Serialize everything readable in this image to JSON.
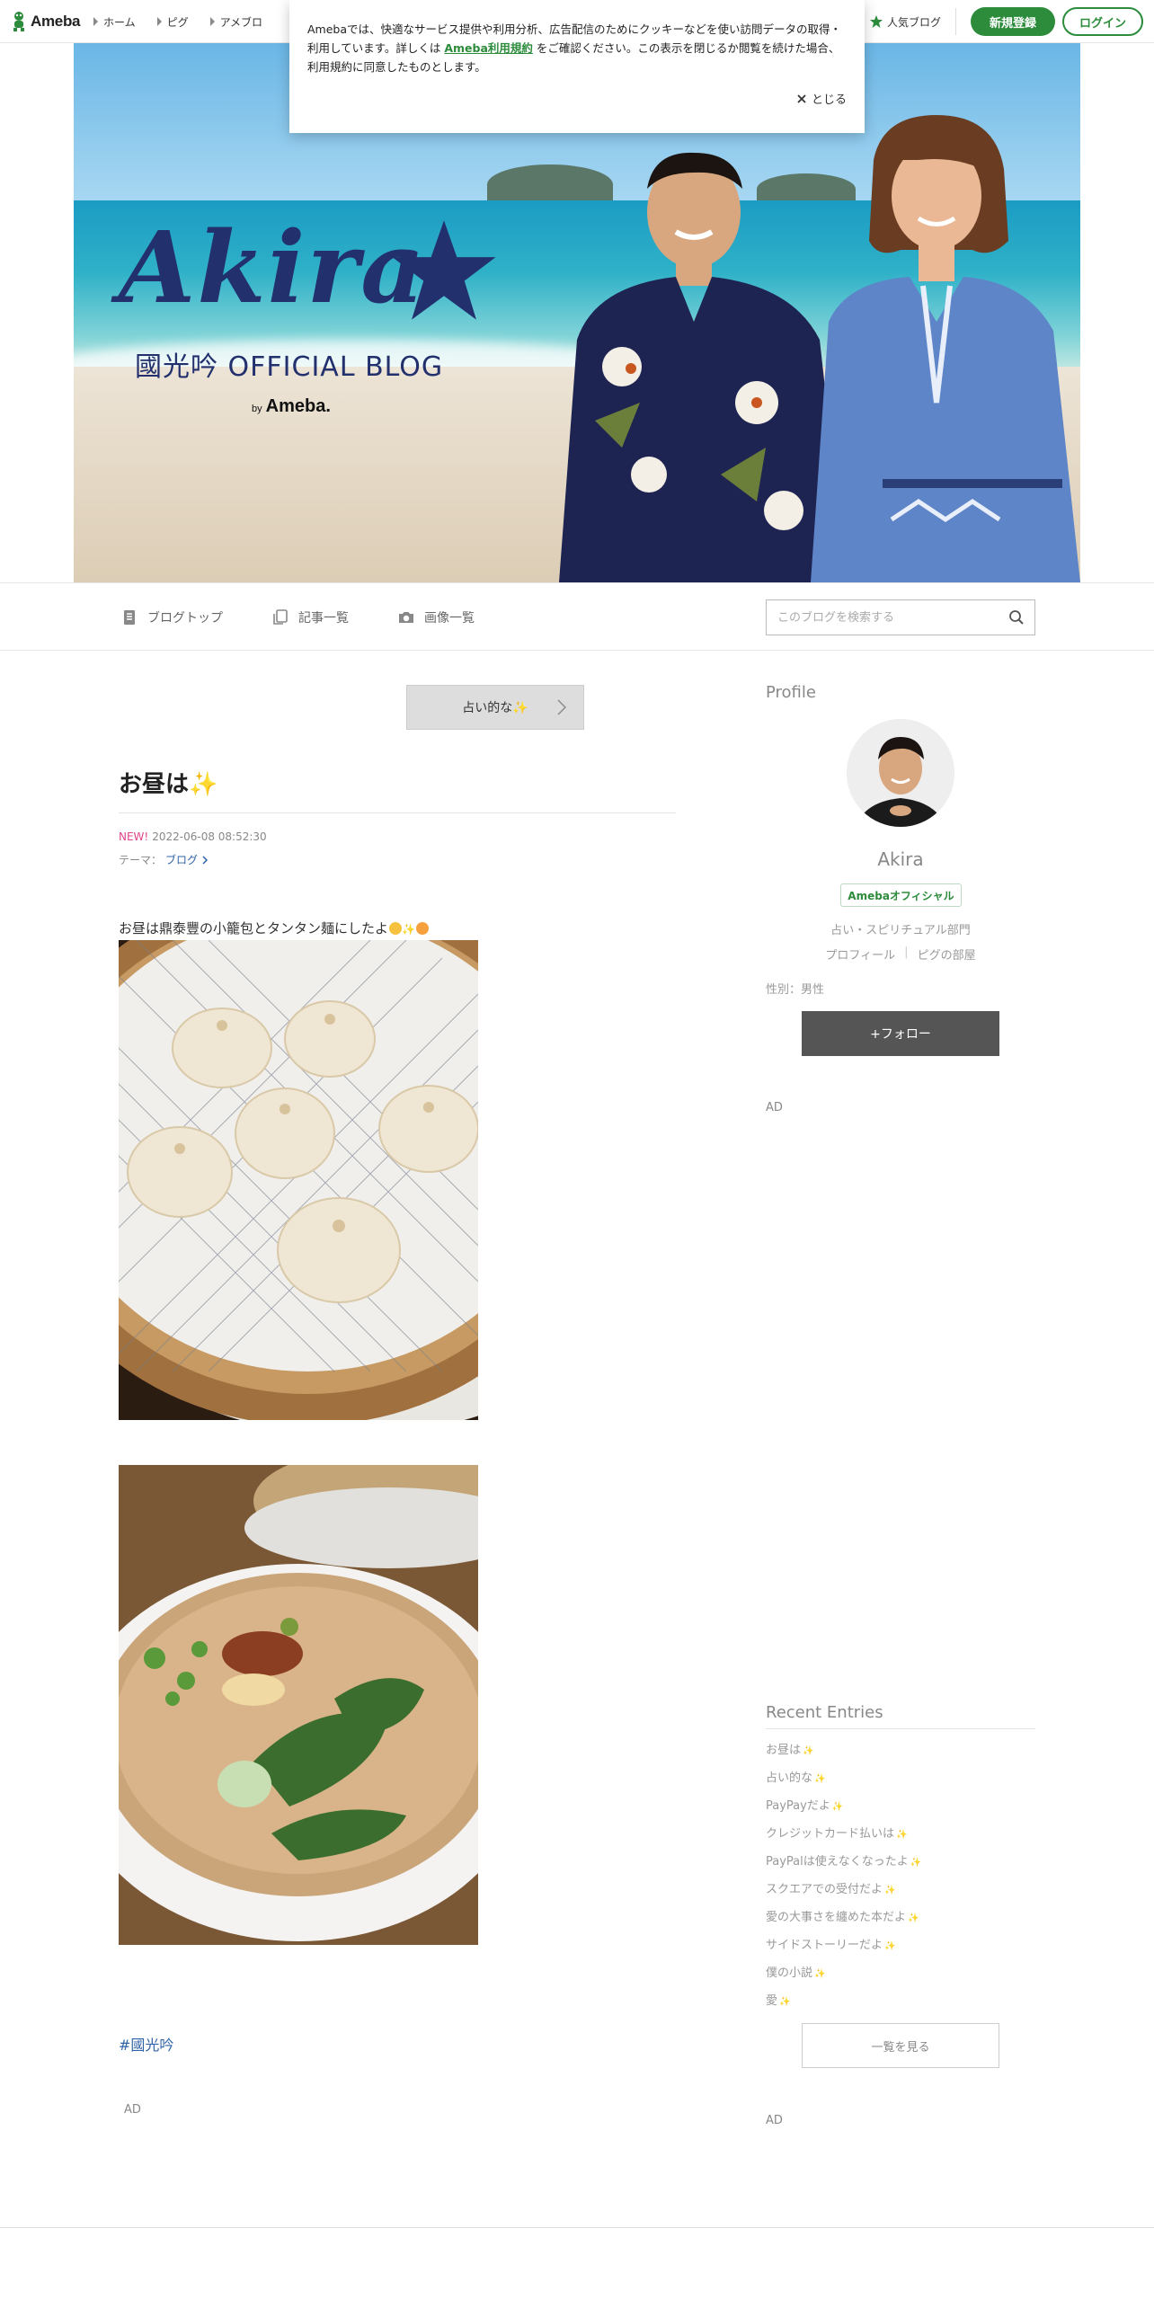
{
  "header": {
    "logo_text": "Ameba",
    "nav": [
      "ホーム",
      "ピグ",
      "アメブロ"
    ],
    "popular_label": "人気ブログ",
    "signup_label": "新規登録",
    "login_label": "ログイン"
  },
  "cookie": {
    "text_before": "Amebaでは、快適なサービス提供や利用分析、広告配信のためにクッキーなどを使い訪問データの取得・利用しています。詳しくは ",
    "link": "Ameba利用規約",
    "text_after": " をご確認ください。この表示を閉じるか閲覧を続けた場合、利用規約に同意したものとします。",
    "close_label": "とじる"
  },
  "hero": {
    "title": "Akira",
    "subtitle": "國光吟 OFFICIAL BLOG",
    "by_small": "by",
    "by_brand": "Ameba."
  },
  "blognav": {
    "items": [
      "ブログトップ",
      "記事一覧",
      "画像一覧"
    ],
    "search_placeholder": "このブログを検索する"
  },
  "entry": {
    "prev_label": "占い的な✨",
    "title": "お昼は✨",
    "new_badge": "NEW!",
    "date": "2022-06-08 08:52:30",
    "theme_prefix": "テーマ：",
    "theme": "ブログ",
    "body": "お昼は鼎泰豐の小籠包とタンタン麺にしたよ",
    "hashtag": "#國光吟",
    "ad": "AD"
  },
  "sidebar": {
    "profile_heading": "Profile",
    "name": "Akira",
    "official_badge": "Amebaオフィシャル",
    "category": "占い・スピリチュアル部門",
    "links": [
      "プロフィール",
      "ピグの部屋"
    ],
    "gender": "性別：男性",
    "follow_label": "+フォロー",
    "ad1": "AD",
    "recent_heading": "Recent Entries",
    "recent": [
      "お昼は",
      "占い的な",
      "PayPayだよ",
      "クレジットカード払いは",
      "PayPalは使えなくなったよ",
      "スクエアでの受付だよ",
      "愛の大事さを纏めた本だよ",
      "サイドストーリーだよ",
      "僕の小説",
      "愛"
    ],
    "see_all_label": "一覧を見る",
    "ad2": "AD"
  },
  "colors": {
    "ameba_green": "#2d8c3c",
    "link_blue": "#2e63a6",
    "new_pink": "#e0458b",
    "follow_gray": "#555555"
  },
  "icons": [
    "ameba-logo-icon",
    "star-icon",
    "close-icon",
    "blog-top-icon",
    "entries-icon",
    "camera-icon",
    "search-icon",
    "chevron-right-icon",
    "sparkle-icon",
    "smile-emoji-icon",
    "kiss-emoji-icon"
  ]
}
